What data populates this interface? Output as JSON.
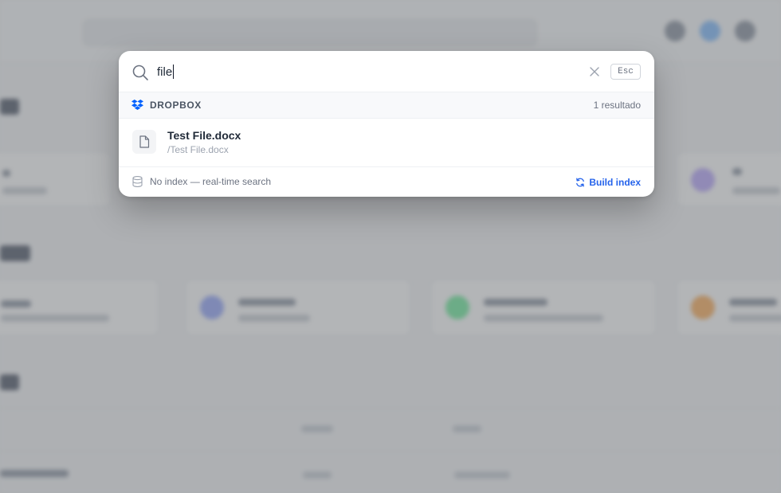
{
  "search": {
    "value": "file",
    "esc_label": "Esc",
    "icon": "search-icon",
    "clear_icon": "close-icon"
  },
  "group": {
    "icon": "dropbox-icon",
    "label": "DROPBOX",
    "count": "1 resultado"
  },
  "results": [
    {
      "icon": "file-icon",
      "name": "Test File.docx",
      "path": "/Test File.docx"
    }
  ],
  "footer": {
    "icon": "database-icon",
    "status": "No index — real-time search",
    "action_icon": "refresh-icon",
    "action_label": "Build index"
  },
  "colors": {
    "accent": "#2563eb",
    "dropbox": "#0061fe",
    "overlay": "#4b4e54"
  }
}
